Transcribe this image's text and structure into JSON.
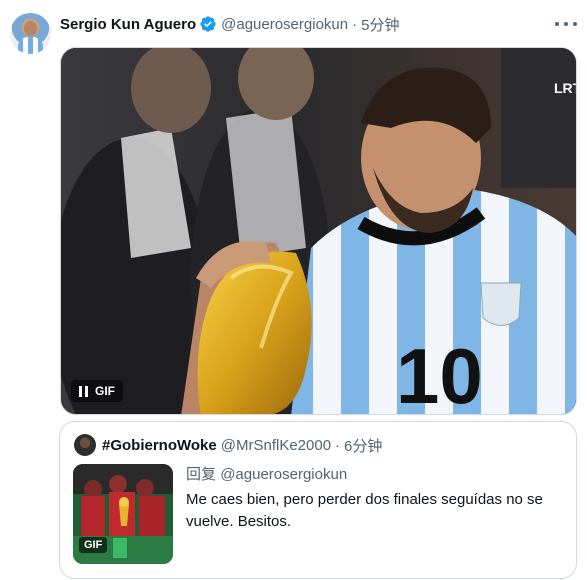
{
  "tweet": {
    "author_name": "Sergio Kun Aguero",
    "handle": "@aguerosergiokun",
    "separator": "·",
    "timestamp": "5分钟",
    "verified_color": "#1d9bf0",
    "media": {
      "type": "gif",
      "badge": "GIF",
      "state": "playing"
    }
  },
  "quoted": {
    "author_name": "#GobiernoWoke",
    "handle": "@MrSnflKe2000",
    "separator": "·",
    "timestamp": "6分钟",
    "reply_prefix": "回复",
    "reply_to": "@aguerosergiokun",
    "text": "Me caes bien, pero perder dos finales seguídas no se vuelve. Besitos.",
    "thumb_badge": "GIF"
  },
  "colors": {
    "text": "#0f1419",
    "secondary": "#536471",
    "border": "#cfd9de",
    "accent": "#1d9bf0"
  }
}
